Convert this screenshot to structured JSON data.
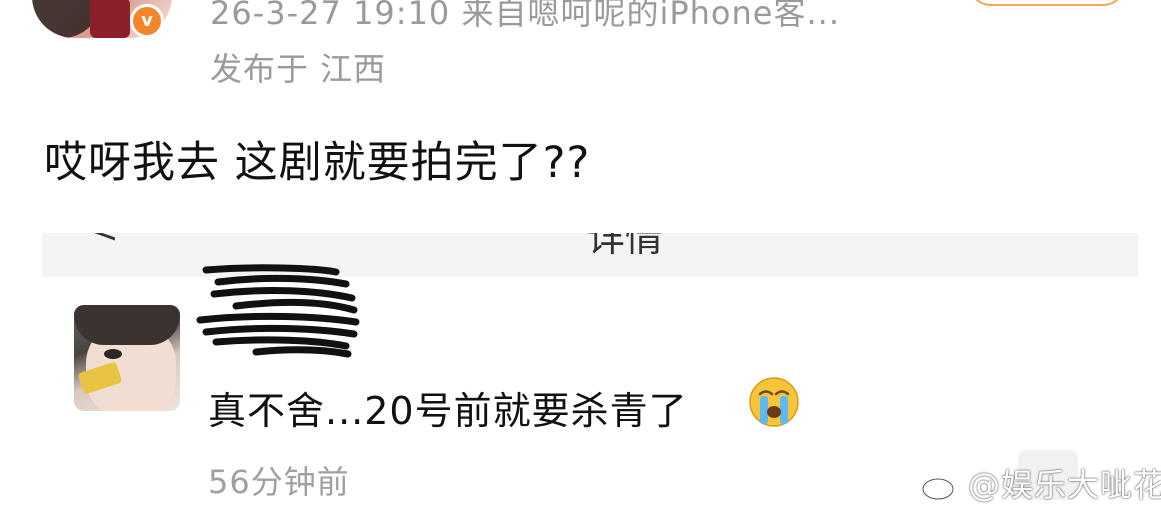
{
  "post": {
    "meta": "26-3-27 19:10  来自嗯呵呢的iPhone客...",
    "location": "发布于 江西",
    "text": "哎呀我去 这剧就要拍完了??"
  },
  "screenshot": {
    "header_back": "<",
    "header_title": "详情",
    "comment": {
      "text": "真不舍...20号前就要杀青了",
      "emoji": "crying-face",
      "time": "56分钟前"
    }
  },
  "watermark": {
    "text": "@娱乐大呲花"
  },
  "colors": {
    "verified": "#f6852a",
    "follow_border": "#f6a35b",
    "muted_text": "#9a9a9a"
  }
}
